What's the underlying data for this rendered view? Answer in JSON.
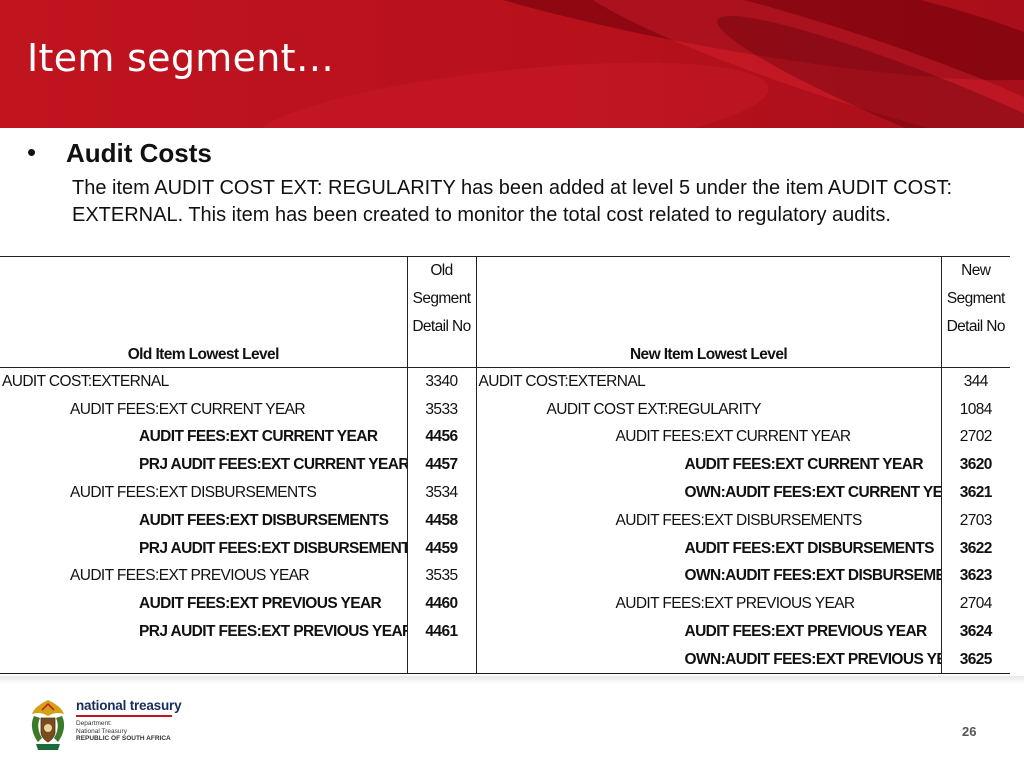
{
  "slide": {
    "title": "Item segment…",
    "bullet": "Audit Costs",
    "description": "The item AUDIT COST EXT: REGULARITY has been added at level 5 under the item AUDIT COST: EXTERNAL. This item has been created to monitor the total cost related to regulatory audits.",
    "page_number": "26"
  },
  "table": {
    "headers": {
      "old_item": "Old Item Lowest Level",
      "old_no": [
        "Old",
        "Segment",
        "Detail No"
      ],
      "new_item": "New Item Lowest Level",
      "new_no": [
        "New",
        "Segment",
        "Detail No"
      ]
    },
    "rows": [
      {
        "old": "AUDIT COST:EXTERNAL",
        "old_no": "3340",
        "new": "AUDIT COST:EXTERNAL",
        "new_no": "344"
      },
      {
        "old": "AUDIT FEES:EXT CURRENT YEAR",
        "old_no": "3533",
        "new": "AUDIT COST EXT:REGULARITY",
        "new_no": "1084"
      },
      {
        "old": "AUDIT FEES:EXT CURRENT YEAR",
        "old_no": "4456",
        "new": "AUDIT FEES:EXT CURRENT YEAR",
        "new_no": "2702"
      },
      {
        "old": "PRJ AUDIT FEES:EXT CURRENT YEAR",
        "old_no": "4457",
        "new": "AUDIT FEES:EXT CURRENT YEAR",
        "new_no": "3620"
      },
      {
        "old": "AUDIT FEES:EXT DISBURSEMENTS",
        "old_no": "3534",
        "new": "OWN:AUDIT FEES:EXT CURRENT YEAR",
        "new_no": "3621"
      },
      {
        "old": "AUDIT FEES:EXT DISBURSEMENTS",
        "old_no": "4458",
        "new": "AUDIT FEES:EXT DISBURSEMENTS",
        "new_no": "2703"
      },
      {
        "old": "PRJ AUDIT FEES:EXT DISBURSEMENTS",
        "old_no": "4459",
        "new": "AUDIT FEES:EXT DISBURSEMENTS",
        "new_no": "3622"
      },
      {
        "old": "AUDIT FEES:EXT PREVIOUS YEAR",
        "old_no": "3535",
        "new": "OWN:AUDIT FEES:EXT DISBURSEMENTS",
        "new_no": "3623"
      },
      {
        "old": "AUDIT FEES:EXT PREVIOUS YEAR",
        "old_no": "4460",
        "new": "AUDIT FEES:EXT PREVIOUS YEAR",
        "new_no": "2704"
      },
      {
        "old": "PRJ AUDIT FEES:EXT PREVIOUS YEAR",
        "old_no": "4461",
        "new": "AUDIT FEES:EXT PREVIOUS YEAR",
        "new_no": "3624"
      },
      {
        "old": "",
        "old_no": "",
        "new": "OWN:AUDIT FEES:EXT PREVIOUS YEAR",
        "new_no": "3625"
      }
    ]
  },
  "footer": {
    "org_name": "national treasury",
    "dept_line1": "Department:",
    "dept_line2": "National Treasury",
    "dept_line3": "REPUBLIC OF SOUTH AFRICA"
  },
  "colors": {
    "banner_red": "#c0141f",
    "text": "#111111",
    "logo_blue": "#1a2d5a"
  }
}
